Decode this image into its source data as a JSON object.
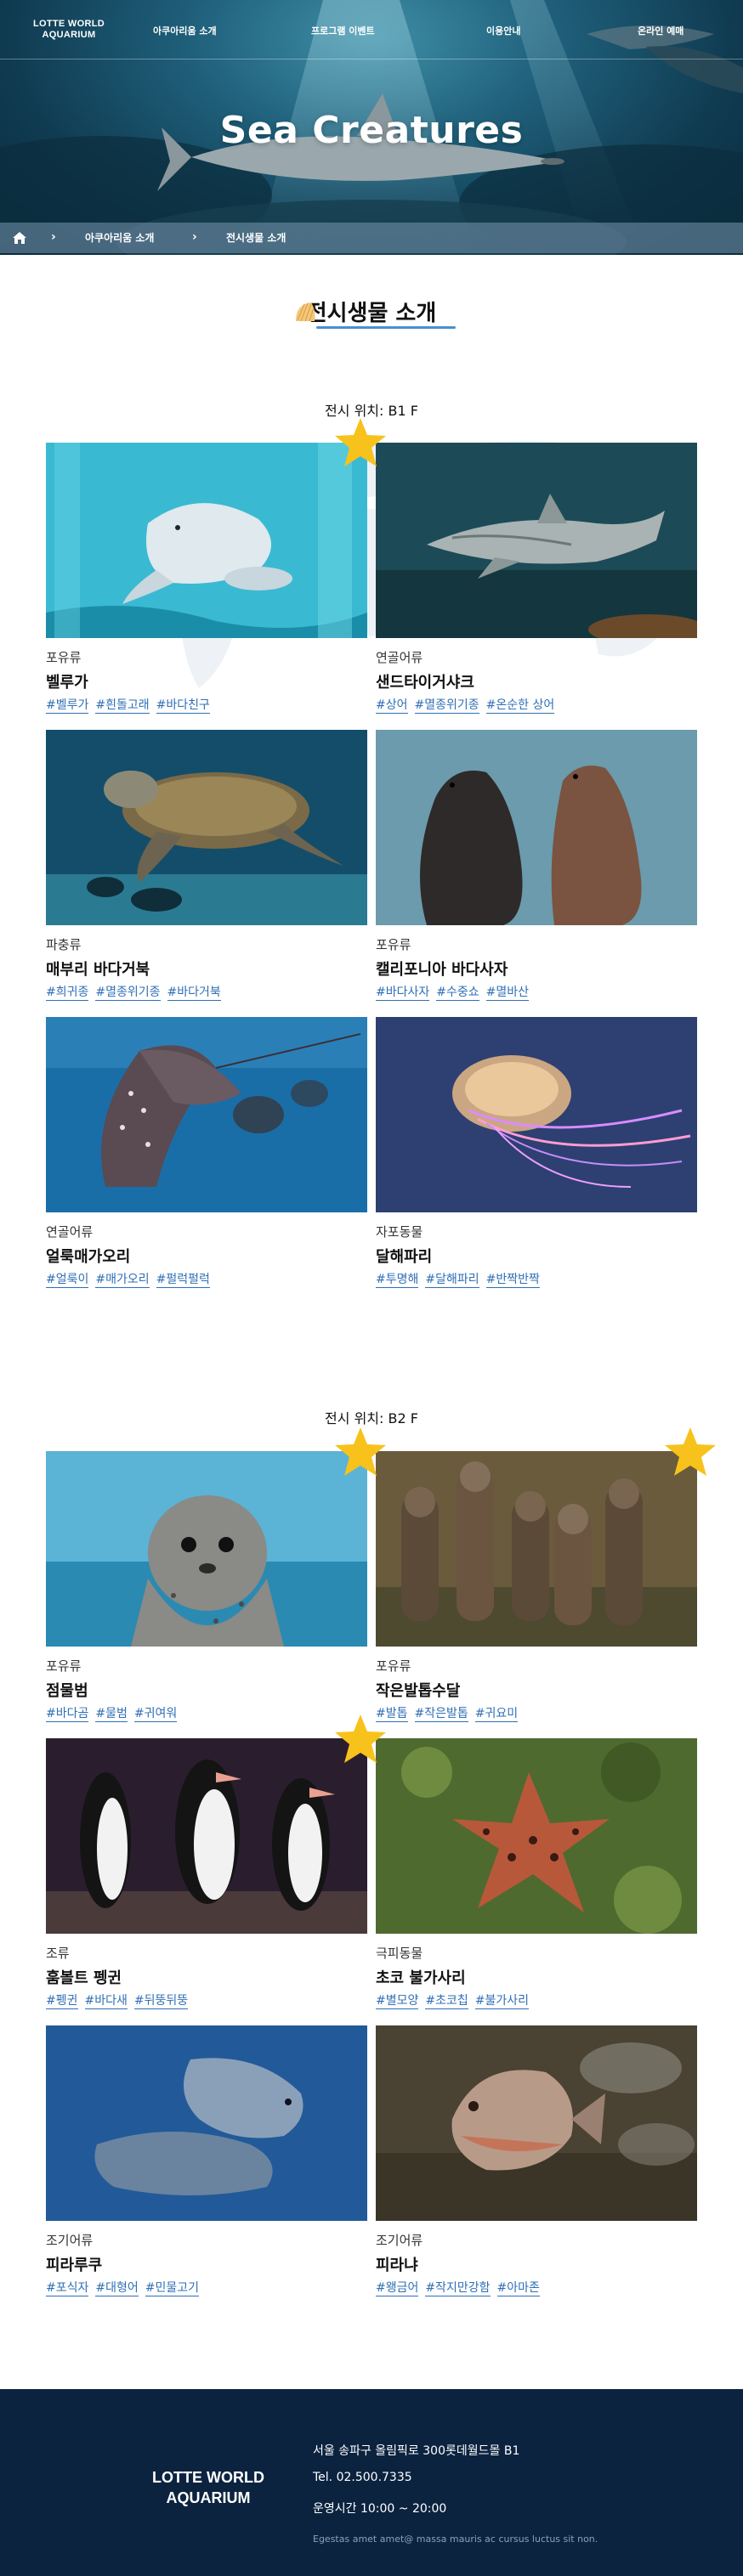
{
  "header": {
    "logo_line1": "LOTTE WORLD",
    "logo_line2": "AQUARIUM",
    "menu": [
      "아쿠아리움 소개",
      "프로그램 이벤트",
      "이용안내",
      "온라인 예매"
    ],
    "hero_title": "Sea Creatures",
    "breadcrumb": [
      "아쿠아리움 소개",
      "전시생물 소개"
    ]
  },
  "section": {
    "title": "전시생물 소개"
  },
  "floors": [
    {
      "label": "전시 위치: B1 F",
      "creatures": [
        {
          "category": "포유류",
          "name": "벨루가",
          "tags": [
            "#벨루가",
            "#흰돌고래",
            "#바다친구"
          ]
        },
        {
          "category": "연골어류",
          "name": "샌드타이거샤크",
          "tags": [
            "#상어",
            "#멸종위기종",
            "#온순한 상어"
          ]
        },
        {
          "category": "파충류",
          "name": "매부리 바다거북",
          "tags": [
            "#희귀종",
            "#멸종위기종",
            "#바다거북"
          ]
        },
        {
          "category": "포유류",
          "name": "캘리포니아 바다사자",
          "tags": [
            "#바다사자",
            "#수중쇼",
            "#멸바산"
          ]
        },
        {
          "category": "연골어류",
          "name": "얼룩매가오리",
          "tags": [
            "#얼룩이",
            "#매가오리",
            "#펄럭펄럭"
          ]
        },
        {
          "category": "자포동물",
          "name": "달해파리",
          "tags": [
            "#투명해",
            "#달해파리",
            "#반짝반짝"
          ]
        }
      ]
    },
    {
      "label": "전시 위치: B2 F",
      "creatures": [
        {
          "category": "포유류",
          "name": "점물범",
          "tags": [
            "#바다곰",
            "#물범",
            "#귀여워"
          ]
        },
        {
          "category": "포유류",
          "name": "작은발톱수달",
          "tags": [
            "#발톱",
            "#작은발톱",
            "#귀요미"
          ]
        },
        {
          "category": "조류",
          "name": "훔볼트 펭귄",
          "tags": [
            "#펭귄",
            "#바다새",
            "#뒤뚱뒤뚱"
          ]
        },
        {
          "category": "극피동물",
          "name": "초코 불가사리",
          "tags": [
            "#별모양",
            "#초코칩",
            "#불가사리"
          ]
        },
        {
          "category": "조기어류",
          "name": "피라루쿠",
          "tags": [
            "#포식자",
            "#대형어",
            "#민물고기"
          ]
        },
        {
          "category": "조기어류",
          "name": "피라냐",
          "tags": [
            "#왱금어",
            "#작지만강함",
            "#아마존"
          ]
        }
      ]
    }
  ],
  "footer": {
    "logo_line1": "LOTTE WORLD",
    "logo_line2": "AQUARIUM",
    "address": "서울 송파구 올림픽로 300롯데월드몰 B1",
    "tel": "Tel. 02.500.7335",
    "hours": "운영시간 10:00 ~ 20:00",
    "small": "Egestas amet amet@ massa mauris ac cursus luctus sit non."
  },
  "colors": {
    "accent": "#2f6fb5",
    "star": "#f7c21c",
    "footer_bg": "#0c2340"
  },
  "icons": [
    "home-icon",
    "chevron-right-icon",
    "star-icon",
    "shell-icon"
  ]
}
